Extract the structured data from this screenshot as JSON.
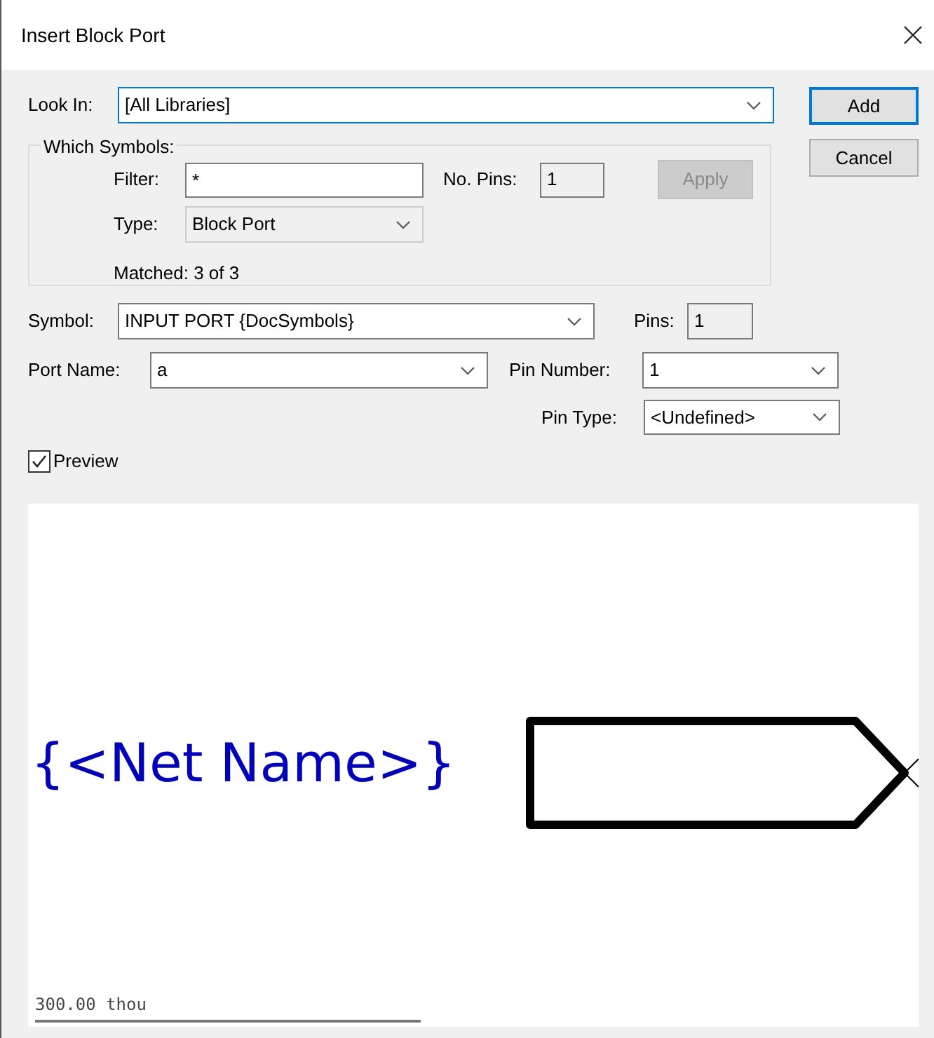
{
  "window": {
    "title": "Insert Block Port"
  },
  "look_in": {
    "label": "Look In:",
    "value": "[All Libraries]"
  },
  "buttons": [
    {
      "label": "Add",
      "default": true
    },
    {
      "label": "Cancel",
      "default": false
    }
  ],
  "which_symbols": {
    "title": "Which Symbols:",
    "filter": {
      "label": "Filter:",
      "value": "*"
    },
    "no_pins": {
      "label": "No. Pins:",
      "value": "1"
    },
    "apply": {
      "label": "Apply",
      "disabled": true
    },
    "type": {
      "label": "Type:",
      "value": "Block Port",
      "disabled": true
    },
    "matched": "Matched: 3 of 3"
  },
  "symbol": {
    "label": "Symbol:",
    "value": "INPUT PORT {DocSymbols}"
  },
  "pins": {
    "label": "Pins:",
    "value": "1"
  },
  "port_name": {
    "label": "Port Name:",
    "value": "a"
  },
  "pin_number": {
    "label": "Pin Number:",
    "value": "1"
  },
  "pin_type": {
    "label": "Pin Type:",
    "value": "<Undefined>"
  },
  "preview": {
    "label": "Preview",
    "checked": true
  },
  "preview_pane": {
    "net_name": "{<Net Name>}",
    "scale": "300.00 thou"
  }
}
